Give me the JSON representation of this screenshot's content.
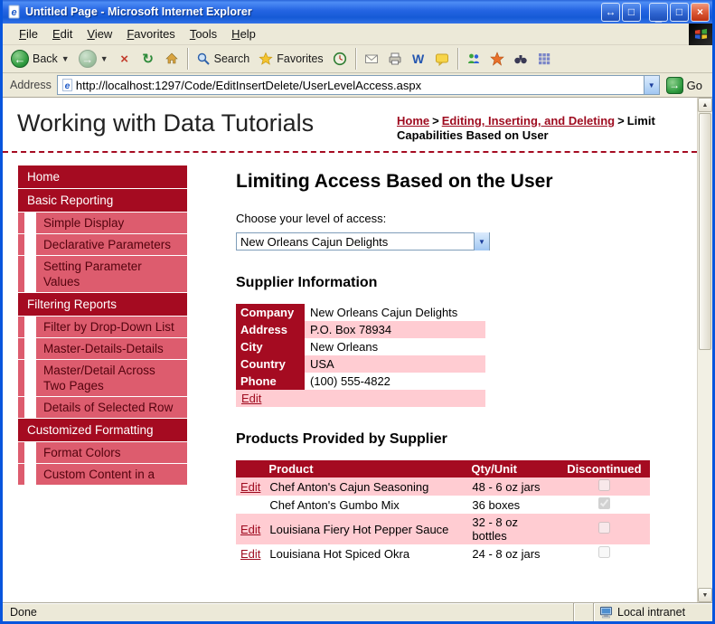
{
  "window": {
    "title": "Untitled Page - Microsoft Internet Explorer",
    "menu": {
      "items": [
        {
          "label": "File"
        },
        {
          "label": "Edit"
        },
        {
          "label": "View"
        },
        {
          "label": "Favorites"
        },
        {
          "label": "Tools"
        },
        {
          "label": "Help"
        }
      ]
    },
    "toolbar": {
      "back_label": "Back",
      "search_label": "Search",
      "favorites_label": "Favorites"
    },
    "address_bar": {
      "label": "Address",
      "url": "http://localhost:1297/Code/EditInsertDelete/UserLevelAccess.aspx",
      "go_label": "Go"
    },
    "status_bar": {
      "status": "Done",
      "zone": "Local intranet"
    }
  },
  "page": {
    "masthead": {
      "title": "Working with Data Tutorials",
      "breadcrumb": {
        "separator": ">",
        "items": [
          {
            "label": "Home",
            "type": "link"
          },
          {
            "label": "Editing, Inserting, and Deleting",
            "type": "link"
          },
          {
            "label": "Limit Capabilities Based on User",
            "type": "current"
          }
        ]
      }
    },
    "sidebar": {
      "items": [
        {
          "label": "Home",
          "type": "section"
        },
        {
          "label": "Basic Reporting",
          "type": "section"
        },
        {
          "label": "Simple Display",
          "type": "item"
        },
        {
          "label": "Declarative Parameters",
          "type": "item"
        },
        {
          "label": "Setting Parameter Values",
          "type": "item"
        },
        {
          "label": "Filtering Reports",
          "type": "section"
        },
        {
          "label": "Filter by Drop-Down List",
          "type": "item"
        },
        {
          "label": "Master-Details-Details",
          "type": "item"
        },
        {
          "label": "Master/Detail Across Two Pages",
          "type": "item"
        },
        {
          "label": "Details of Selected Row",
          "type": "item"
        },
        {
          "label": "Customized Formatting",
          "type": "section"
        },
        {
          "label": "Format Colors",
          "type": "item"
        },
        {
          "label": "Custom Content in a",
          "type": "item"
        }
      ]
    },
    "main": {
      "heading": "Limiting Access Based on the User",
      "access_label": "Choose your level of access:",
      "access_select": {
        "value": "New Orleans Cajun Delights"
      },
      "supplier": {
        "heading": "Supplier Information",
        "rows": [
          {
            "label": "Company",
            "value": "New Orleans Cajun Delights"
          },
          {
            "label": "Address",
            "value": "P.O. Box 78934"
          },
          {
            "label": "City",
            "value": "New Orleans"
          },
          {
            "label": "Country",
            "value": "USA"
          },
          {
            "label": "Phone",
            "value": "(100) 555-4822"
          }
        ],
        "edit_label": "Edit"
      },
      "products": {
        "heading": "Products Provided by Supplier",
        "columns": {
          "edit": "",
          "product": "Product",
          "qty": "Qty/Unit",
          "discontinued": "Discontinued"
        },
        "rows": [
          {
            "edit": "Edit",
            "product": "Chef Anton's Cajun Seasoning",
            "qty": "48 - 6 oz jars",
            "discontinued": false
          },
          {
            "edit": "",
            "product": "Chef Anton's Gumbo Mix",
            "qty": "36 boxes",
            "discontinued": true
          },
          {
            "edit": "Edit",
            "product": "Louisiana Fiery Hot Pepper Sauce",
            "qty": "32 - 8 oz bottles",
            "discontinued": false
          },
          {
            "edit": "Edit",
            "product": "Louisiana Hot Spiced Okra",
            "qty": "24 - 8 oz jars",
            "discontinued": false
          }
        ]
      }
    },
    "colors": {
      "brand_dark_red": "#A50B21",
      "sidebar_item_pink": "#DD5C6E",
      "table_row_pink": "#FFCCD2",
      "link_red": "#9E0B1F",
      "titlebar_blue": "#0855DD"
    }
  }
}
